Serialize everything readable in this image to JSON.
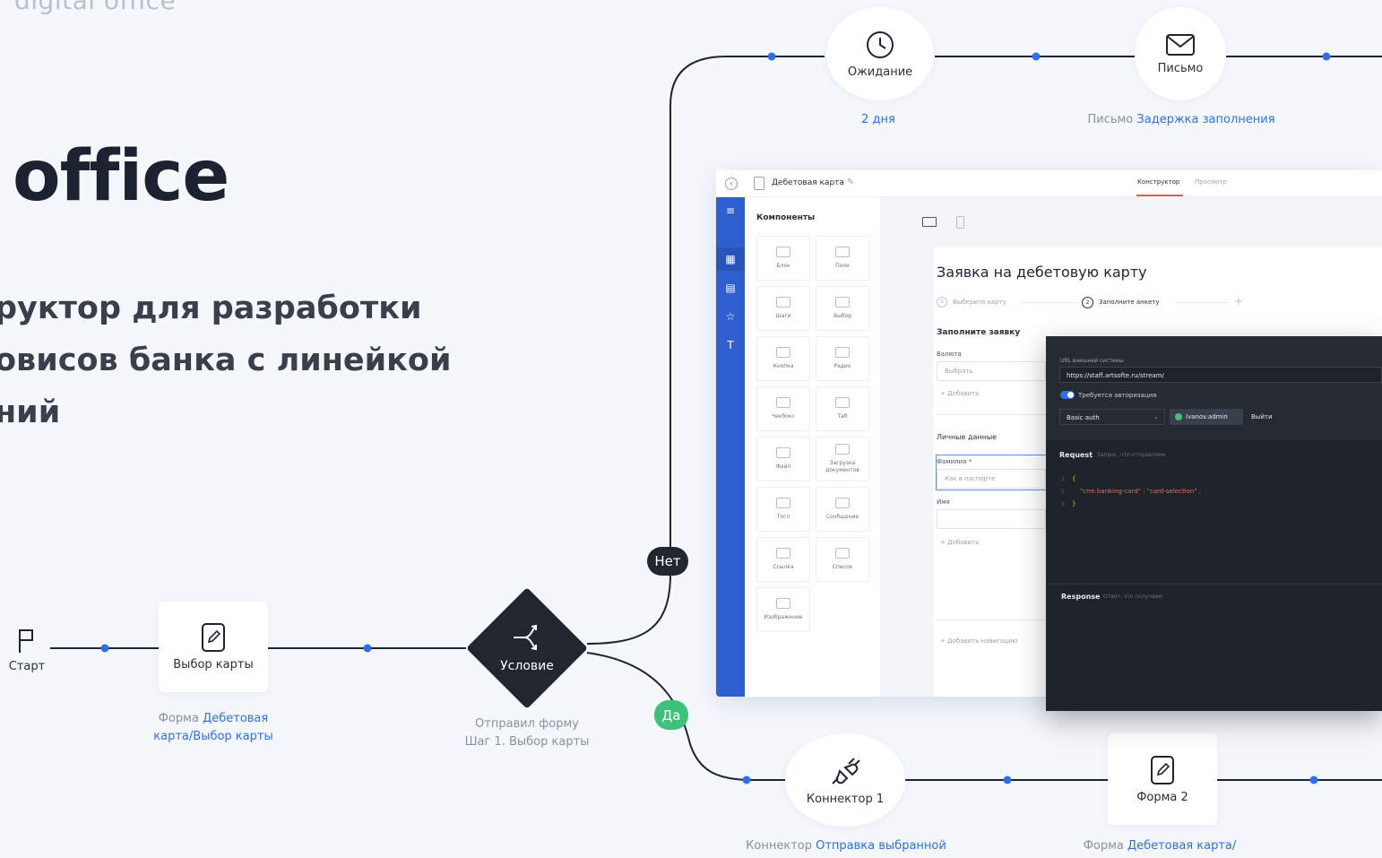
{
  "hero": {
    "brand": "digital office",
    "title": "office",
    "subtitle_lines": [
      "руктор для разработки",
      "овисов банка с линейкой",
      "ний"
    ]
  },
  "colors": {
    "background": "#f4f7fc",
    "line": "#1f2430",
    "dot": "#2d6ff0",
    "link": "#2d6ff0",
    "no_pill": "#22262f",
    "yes_pill": "#3ec27a",
    "rail": "#2f5fcf"
  },
  "flow": {
    "start": {
      "label": "Старт",
      "icon": "flag-icon"
    },
    "card_select": {
      "label": "Выбор карты",
      "icon": "edit-form-icon",
      "caption_prefix": "Форма",
      "caption_link_1": "Дебетовая",
      "caption_link_2": "карта/Выбор карты"
    },
    "condition": {
      "label": "Условие",
      "icon": "split-icon",
      "caption_1": "Отправил форму",
      "caption_2": "Шаг 1. Выбор карты"
    },
    "no_label": "Нет",
    "yes_label": "Да",
    "wait": {
      "label": "Ожидание",
      "icon": "clock-icon",
      "caption": "2 дня"
    },
    "letter": {
      "label": "Письмо",
      "icon": "mail-icon",
      "caption_prefix": "Письмо",
      "caption_link": "Задержка заполнения"
    },
    "connector": {
      "label": "Коннектор 1",
      "icon": "plug-icon",
      "caption_prefix": "Коннектор",
      "caption_link": "Отправка выбранной"
    },
    "form2": {
      "label": "Форма 2",
      "icon": "edit-form-icon",
      "caption_prefix": "Форма",
      "caption_link": "Дебетовая карта/"
    }
  },
  "app": {
    "doc_title": "Дебетовая карта",
    "tab_constructor": "Конструктор",
    "tab_preview": "Просмотр",
    "components_title": "Компоненты",
    "components": [
      {
        "label": "Блок"
      },
      {
        "label": "Поле"
      },
      {
        "label": "Шаги"
      },
      {
        "label": "Выбор"
      },
      {
        "label": "Кнопка"
      },
      {
        "label": "Радио"
      },
      {
        "label": "Чекбокс"
      },
      {
        "label": "Таб"
      },
      {
        "label": "Файл"
      },
      {
        "label": "Загрузка документов"
      },
      {
        "label": "Тогл"
      },
      {
        "label": "Сообщение"
      },
      {
        "label": "Ссылка"
      },
      {
        "label": "Список"
      },
      {
        "label": "Изображение"
      }
    ],
    "form_title": "Заявка на дебетовую карту",
    "step1_num": "1",
    "step1": "Выберите карту",
    "step2_num": "2",
    "step2": "Заполните анкету",
    "section_fill": "Заполните заявку",
    "currency_label": "Валюта",
    "currency_placeholder": "Выбрать",
    "add": "Добавить",
    "personal_section": "Личные данные",
    "surname_label": "Фамилия *",
    "surname_placeholder": "Как в паспорте",
    "name_label": "Имя",
    "add_navigation": "Добавить навигацию"
  },
  "connector_panel": {
    "url_label": "URL внешней системы",
    "url_value": "https://staff.artsofte.ru/stream/",
    "auth_toggle": "Требуется авторизация",
    "auth_type": "Basic auth",
    "user": "ivanov.admin",
    "logout": "Выйти",
    "request_title": "Request",
    "request_hint": "Запрос, что отправляем",
    "code_lines": [
      "{",
      "\"crm.banking-card\" : \"card-selection\" ,",
      "}"
    ],
    "line_numbers": [
      "1",
      "2",
      "3"
    ],
    "response_title": "Response",
    "response_hint": "Ответ, что получаем"
  }
}
